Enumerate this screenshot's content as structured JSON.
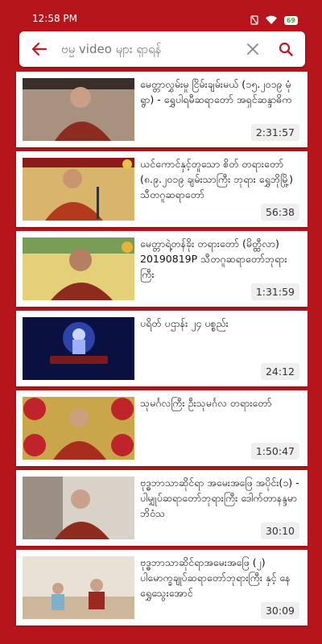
{
  "status": {
    "time": "12:58 PM",
    "battery": "69"
  },
  "search": {
    "placeholder": "ဗမ္မ video များ ရှာရန်"
  },
  "colors": {
    "accent": "#b5151b"
  },
  "videos": [
    {
      "title": "မေတ္တာလွှမ်းမှု ငြိမ်းချမ်းမယ် (၁၅.၂၀၁၉ မုံရွာ) - ရွှေပါရမီဆရာတော် အရှင်ဆန္ဒာဓိက",
      "duration": "2:31:57"
    },
    {
      "title": "ယင်ကောင်နှင့်တူသော စိတ် တရားတော် (၈.၉.၂၀၁၉ ချမ်းသာကြီး ဘုရား ရွှေဘိုမြို့) သီတဂူဆရာတော်",
      "duration": "56:38"
    },
    {
      "title": "မေတ္တာရဲ့တန်ခိုး တရားတော် (မိတ္ထီလာ) 20190819P သီတဂူဆရာတော်ဘုရားကြီး",
      "duration": "1:31:59"
    },
    {
      "title": "ပရိတ် ပဌာန်း ၂၄ ပစ္စည်း",
      "duration": "24:12"
    },
    {
      "title": "သုမင်္ဂလကြီး ဦးသုမင်္ဂလ တရားတော်",
      "duration": "1:50:47"
    },
    {
      "title": "ဗုဒ္ဓဘာသာဆိုင်ရာ အမေးအဖြေ အပိုင်း(၁) - ပါမျှုပ်ဆရာတော်ဘုရားကြီး ဒေါက်တာနန္ဒမာဘိဝံသ",
      "duration": "30:10"
    },
    {
      "title": "ဗုဒ္ဓဘာသာဆိုင်ရာအမေးအဖြေ (၂) ပါမောက္ခချုပ်ဆရာတော်ဘုရားကြီး နှင့် နေရွှေသွေးအောင်",
      "duration": "30:09"
    }
  ]
}
